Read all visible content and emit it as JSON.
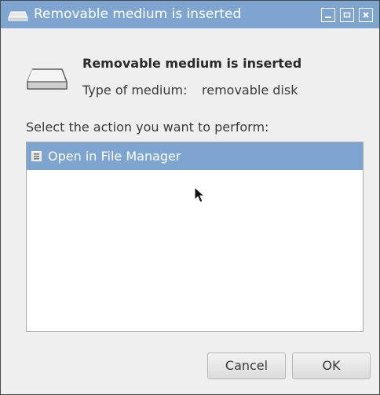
{
  "window": {
    "title": "Removable medium is inserted",
    "title_icon": "drive-icon",
    "controls": [
      "minimize-icon",
      "maximize-icon",
      "close-icon"
    ]
  },
  "content": {
    "heading": "Removable medium is inserted",
    "medium_label": "Type of medium:",
    "medium_value": "removable disk",
    "drive_icon": "removable-drive-icon",
    "prompt": "Select the action you want to perform:"
  },
  "actions": {
    "items": [
      {
        "label": "Open in File Manager",
        "icon": "file-manager-icon",
        "selected": true
      }
    ]
  },
  "buttons": {
    "cancel": "Cancel",
    "ok": "OK"
  },
  "colors": {
    "accent": "#7da5cf",
    "dialog_bg": "#efefef",
    "list_bg": "#ffffff"
  }
}
